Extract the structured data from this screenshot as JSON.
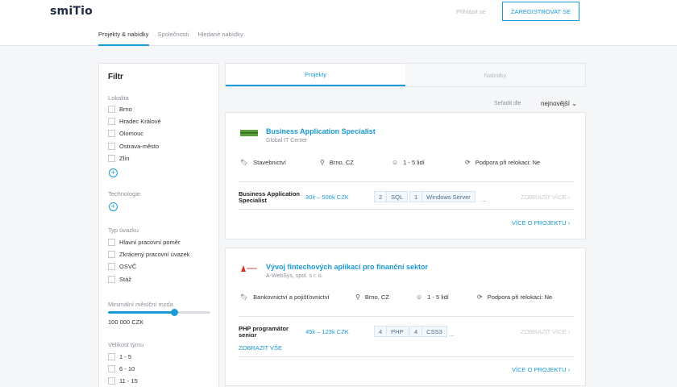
{
  "header": {
    "logo": "smiTio",
    "login_label": "Přihlásit se",
    "register_label": "ZAREGISTROVAT SE",
    "nav": [
      "Projekty & nabídky",
      "Společnosti",
      "Hledané nabídky"
    ]
  },
  "filter": {
    "title": "Filtr",
    "location_label": "Lokalita",
    "locations": [
      "Brno",
      "Hradec Králové",
      "Olomouc",
      "Ostrava-město",
      "Zlín"
    ],
    "technology_label": "Technologie",
    "contract_label": "Typ úvazku",
    "contracts": [
      "Hlavní pracovní poměr",
      "Zkrácený pracovní úvazek",
      "OSVČ",
      "Stáž"
    ],
    "wage_label": "Minimální měsíční mzda",
    "wage_value": "100 000 CZK",
    "wage_fraction": 0.65,
    "team_label": "Velikost týmu",
    "team_sizes": [
      "1 - 5",
      "6 - 10",
      "11 - 15"
    ]
  },
  "tabs": [
    "Projekty",
    "Nabídky"
  ],
  "sort": {
    "label": "Seřadit dle",
    "value": "nejnovější"
  },
  "cards": [
    {
      "title": "Business Application Specialist",
      "company": "Global IT Center",
      "industry": "Stavebnictví",
      "location": "Brno, CZ",
      "team": "1 - 5 lidí",
      "relocation": "Podpora při relokaci: Ne",
      "position": "Business Application Specialist",
      "salary": "30k – 500k CZK",
      "tags": [
        {
          "n": "2",
          "t": "SQL"
        },
        {
          "n": "1",
          "t": "Windows Server"
        }
      ],
      "dots": "...",
      "show_more": "ZOBRAZIT VÍCE",
      "more_project": "VÍCE O PROJEKTU"
    },
    {
      "title": "Vývoj fintechových aplikací pro finanční sektor",
      "company": "A-WebSys, spol. s r. o.",
      "industry": "Bankovnictví a pojišťovnictví",
      "location": "Brno, CZ",
      "team": "1 - 5 lidí",
      "relocation": "Podpora při relokaci: Ne",
      "position": "PHP programátor senior",
      "salary": "45k – 123k CZK",
      "tags": [
        {
          "n": "4",
          "t": "PHP"
        },
        {
          "n": "4",
          "t": "CSS3"
        }
      ],
      "dots": "...",
      "show_more": "ZOBRAZIT VÍCE",
      "show_all": "ZOBRAZIT VŠE",
      "more_project": "VÍCE O PROJEKTU"
    }
  ],
  "colors": {
    "accent": "#1a9bd7",
    "text": "#333333",
    "muted": "#8a9099",
    "border": "#e3e5e8"
  }
}
